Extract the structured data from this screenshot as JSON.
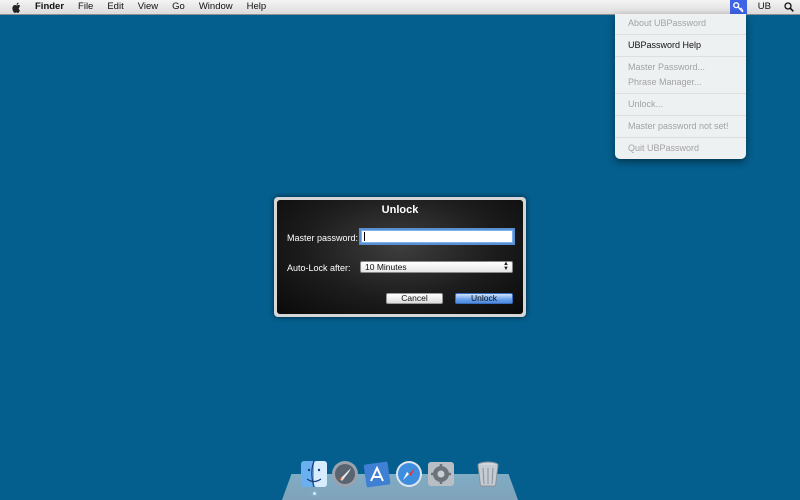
{
  "menubar": {
    "app_name": "Finder",
    "items": [
      "File",
      "Edit",
      "View",
      "Go",
      "Window",
      "Help"
    ],
    "status_item": "UB"
  },
  "menu": {
    "items": [
      {
        "label": "About UBPassword",
        "enabled": false
      },
      {
        "label": "UBPassword Help",
        "enabled": true
      },
      {
        "label": "Master Password...",
        "enabled": false
      },
      {
        "label": "Phrase Manager...",
        "enabled": false
      },
      {
        "label": "Unlock...",
        "enabled": false
      },
      {
        "label": "Master password not set!",
        "enabled": false
      },
      {
        "label": "Quit UBPassword",
        "enabled": false
      }
    ]
  },
  "dialog": {
    "title": "Unlock",
    "password_label": "Master password:",
    "password_value": "",
    "autolock_label": "Auto-Lock after:",
    "autolock_value": "10 Minutes",
    "cancel_label": "Cancel",
    "unlock_label": "Unlock"
  },
  "dock": {
    "icons": [
      "finder-icon",
      "launchpad-icon",
      "app-store-icon",
      "safari-icon",
      "system-preferences-icon",
      "trash-icon"
    ]
  },
  "colors": {
    "desktop": "#045f8e",
    "menu_highlight": "#3d63e6",
    "default_button": "#6aa0e8"
  }
}
